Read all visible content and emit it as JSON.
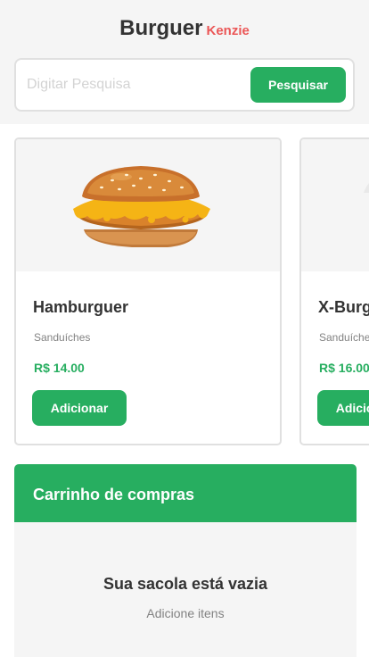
{
  "header": {
    "logo_main": "Burguer",
    "logo_sub": "Kenzie"
  },
  "search": {
    "placeholder": "Digitar Pesquisa",
    "value": "",
    "button_label": "Pesquisar"
  },
  "products": [
    {
      "name": "Hamburguer",
      "category": "Sanduíches",
      "price": "R$ 14.00",
      "button_label": "Adicionar",
      "image": "burger-image"
    },
    {
      "name": "X-Burguer",
      "category": "Sanduíches",
      "price": "R$ 16.00",
      "button_label": "Adicionar",
      "image": "burger-image"
    }
  ],
  "cart": {
    "title": "Carrinho de compras",
    "empty_title": "Sua sacola está vazia",
    "empty_subtitle": "Adicione itens"
  },
  "colors": {
    "primary": "#27ae60",
    "secondary": "#eb5757",
    "gray_bg": "#f5f5f5",
    "text_dark": "#333333",
    "text_gray": "#828282"
  }
}
